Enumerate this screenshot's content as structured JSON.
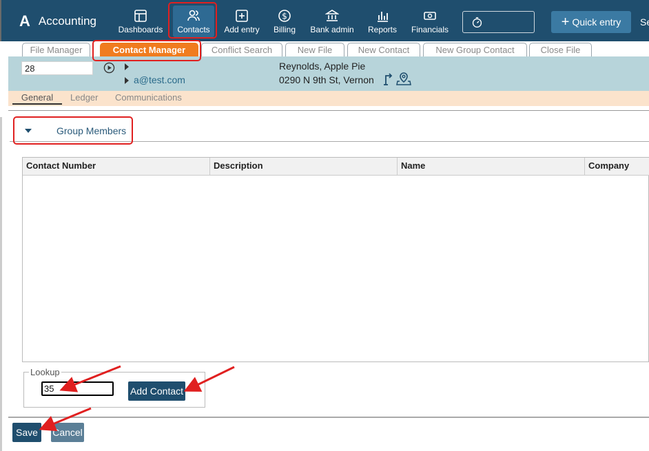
{
  "app": {
    "title": "Accounting",
    "logo": "A"
  },
  "nav": [
    {
      "label": "Dashboards",
      "icon": "dashboard-icon"
    },
    {
      "label": "Contacts",
      "icon": "contacts-icon",
      "active": true
    },
    {
      "label": "Add entry",
      "icon": "add-entry-icon"
    },
    {
      "label": "Billing",
      "icon": "billing-icon"
    },
    {
      "label": "Bank admin",
      "icon": "bank-icon"
    },
    {
      "label": "Reports",
      "icon": "reports-icon"
    },
    {
      "label": "Financials",
      "icon": "financials-icon"
    }
  ],
  "quick_entry": "Quick entry",
  "settings_partial": "Se",
  "tabs": [
    "File Manager",
    "Contact Manager",
    "Conflict Search",
    "New File",
    "New Contact",
    "New Group Contact",
    "Close File"
  ],
  "active_tab": "Contact Manager",
  "contact": {
    "id": "28",
    "email": "a@test.com",
    "name": "Reynolds, Apple Pie",
    "address": "0290 N 9th St, Vernon"
  },
  "subtabs": [
    "General",
    "Ledger",
    "Communications"
  ],
  "active_subtab": "General",
  "group": {
    "title": "Group Members"
  },
  "table": {
    "columns": [
      "Contact Number",
      "Description",
      "Name",
      "Company"
    ]
  },
  "lookup": {
    "label": "Lookup",
    "value": "35",
    "add_button": "Add Contact"
  },
  "footer": {
    "save": "Save",
    "cancel": "Cancel"
  },
  "colors": {
    "nav_bg": "#1f4e6e",
    "active_tab": "#f07c1f",
    "highlight": "#e02020",
    "info_bg": "#b7d4da"
  }
}
